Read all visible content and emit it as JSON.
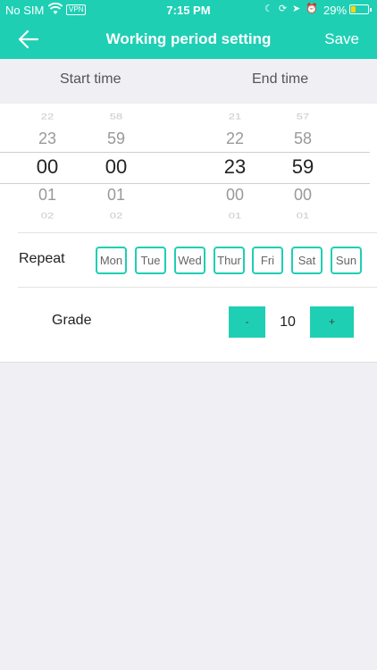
{
  "status_bar": {
    "carrier": "No SIM",
    "vpn": "VPN",
    "time": "7:15 PM",
    "battery": "29%",
    "battery_level": 0.29,
    "battery_color": "#ffd800",
    "icons": [
      "wifi-icon",
      "moon-icon",
      "lock-rotation-icon",
      "location-icon",
      "alarm-icon"
    ]
  },
  "nav": {
    "back_icon": "arrow-left-icon",
    "title": "Working period setting",
    "save": "Save"
  },
  "headers": {
    "start": "Start time",
    "end": "End time"
  },
  "picker": {
    "start_hour": [
      "22",
      "23",
      "00",
      "01",
      "02"
    ],
    "start_minute": [
      "58",
      "59",
      "00",
      "01",
      "02"
    ],
    "end_hour": [
      "21",
      "22",
      "23",
      "00",
      "01"
    ],
    "end_minute": [
      "57",
      "58",
      "59",
      "00",
      "01"
    ]
  },
  "repeat": {
    "label": "Repeat",
    "days": [
      "Mon",
      "Tue",
      "Wed",
      "Thur",
      "Fri",
      "Sat",
      "Sun"
    ]
  },
  "grade": {
    "label": "Grade",
    "minus": "-",
    "value": "10",
    "plus": "+"
  },
  "colors": {
    "accent": "#1ecfb4",
    "background": "#efeff4"
  }
}
